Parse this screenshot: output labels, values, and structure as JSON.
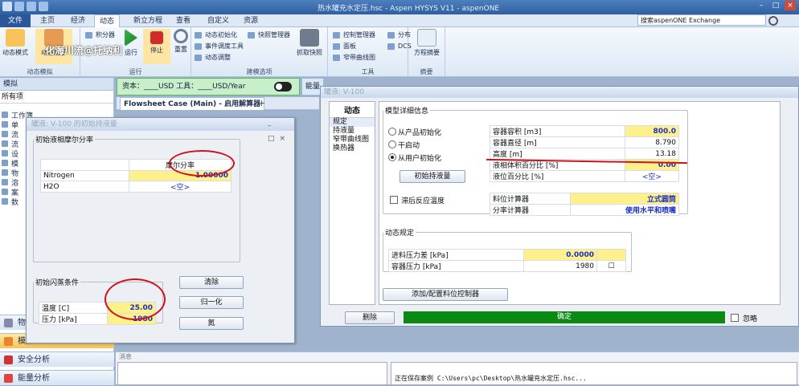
{
  "window": {
    "title": "热水罐充水定压.hsc - Aspen HYSYS V11 - aspenONE"
  },
  "search": {
    "placeholder": "搜索aspenONE Exchange"
  },
  "tabs": [
    {
      "label": "文件"
    },
    {
      "label": "主页"
    },
    {
      "label": "经济"
    },
    {
      "label": "动态"
    },
    {
      "label": "新立方程"
    },
    {
      "label": "查看"
    },
    {
      "label": "自定义"
    },
    {
      "label": "资源"
    }
  ],
  "ribbon": {
    "dyn_mode": "动态模式",
    "dyn_assist": "动态助手",
    "splitter": "积分器",
    "run": "运行",
    "stop": "停止",
    "reset": "重置",
    "group_dynsim": "动态模拟",
    "group_run": "运行",
    "dyn_init": "动态初始化",
    "event_sched": "事件调度工具",
    "dyn_adjust": "动态调整",
    "snapshot_mgr": "快照管理器",
    "take_snapshot": "抓取快照",
    "group_model": "建模选项",
    "ctrl_mgr": "控制管理器",
    "face": "面板",
    "strip": "窄带曲线图",
    "distrib": "分布",
    "dcs": "DCS",
    "group_tools": "工具",
    "eq_summary": "方程摘要",
    "group_summary": "摘要"
  },
  "watermark": "化海川流@托纳利",
  "left": {
    "header": "模拟",
    "selector": "所有项",
    "tree": [
      "工作簿",
      "单",
      "流",
      "流",
      "设",
      "模",
      "物",
      "溶",
      "案",
      "数"
    ],
    "nav": [
      {
        "label": "物"
      },
      {
        "label": "模拟"
      },
      {
        "label": "安全分析"
      },
      {
        "label": "能量分析"
      }
    ]
  },
  "econ": {
    "text": "资本：____USD  工具：____USD/Year"
  },
  "energy": "能量",
  "flowsheet_tab": "Flowsheet Case (Main) - 启用解算器",
  "init_dialog": {
    "title": "罐液: V-100 的初始持液量",
    "comp_legend": "初始液相摩尔分率",
    "comp_header": "摩尔分率",
    "components": [
      {
        "name": "Nitrogen",
        "value": "1.00000"
      },
      {
        "name": "H2O",
        "value": "<空>"
      }
    ],
    "flash_legend": "初始闪蒸条件",
    "temp_label": "温度 [C]",
    "temp_value": "25.00",
    "press_label": "压力 [kPa]",
    "press_value": "1980",
    "btn_clear": "清除",
    "btn_normalize": "归一化",
    "btn_ok": "氮"
  },
  "v100": {
    "title": "罐液: V-100",
    "side_header": "动态",
    "side_items": [
      "规定",
      "持液量",
      "窄带曲线图",
      "换热器"
    ],
    "model_legend": "模型详细信息",
    "radios": [
      "从产品初始化",
      "干启动",
      "从用户初始化"
    ],
    "init_btn": "初始持液量",
    "props": [
      {
        "label": "容器容积 [m3]",
        "value": "800.0"
      },
      {
        "label": "容器直径 [m]",
        "value": "8.790"
      },
      {
        "label": "高度 [m]",
        "value": "13.18"
      },
      {
        "label": "液相体积百分比 [%]",
        "value": "0.00"
      },
      {
        "label": "液位百分比 [%]",
        "value": "<空>"
      }
    ],
    "lag_temp": "滞后反应温度",
    "calc": [
      {
        "label": "料位计算器",
        "value": "立式圆筒"
      },
      {
        "label": "分率计算器",
        "value": "使用水平和喷嘴"
      }
    ],
    "dyn_legend": "动态规定",
    "dyn_rows": [
      {
        "label": "进料压力差 [kPa]",
        "value": "0.0000"
      },
      {
        "label": "容器压力 [kPa]",
        "value": "1980"
      }
    ],
    "add_ctrl_btn": "添加/配置料位控制器",
    "delete_btn": "删除",
    "status": "确定",
    "ignore": "忽略"
  },
  "messages": {
    "header": "消息",
    "log": "正在保存案例 C:\\Users\\pc\\Desktop\\热水罐充水定压.hsc..."
  }
}
